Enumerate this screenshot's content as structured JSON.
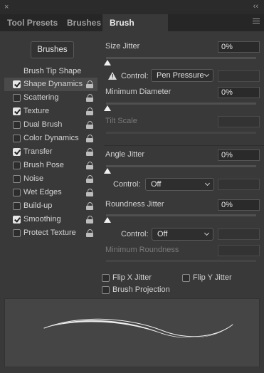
{
  "window": {
    "close_glyph": "×",
    "collapse_glyph": "‹‹"
  },
  "tabs": [
    {
      "label": "Tool Presets",
      "active": false
    },
    {
      "label": "Brushes",
      "active": false
    },
    {
      "label": "Brush Settings",
      "active": true
    }
  ],
  "left": {
    "brushes_button": "Brushes",
    "tip_shape": "Brush Tip Shape",
    "items": [
      {
        "label": "Shape Dynamics",
        "checked": true,
        "selected": true
      },
      {
        "label": "Scattering",
        "checked": false,
        "selected": false
      },
      {
        "label": "Texture",
        "checked": true,
        "selected": false
      },
      {
        "label": "Dual Brush",
        "checked": false,
        "selected": false
      },
      {
        "label": "Color Dynamics",
        "checked": false,
        "selected": false
      },
      {
        "label": "Transfer",
        "checked": true,
        "selected": false
      },
      {
        "label": "Brush Pose",
        "checked": false,
        "selected": false
      },
      {
        "label": "Noise",
        "checked": false,
        "selected": false
      },
      {
        "label": "Wet Edges",
        "checked": false,
        "selected": false
      },
      {
        "label": "Build-up",
        "checked": false,
        "selected": false
      },
      {
        "label": "Smoothing",
        "checked": true,
        "selected": false
      },
      {
        "label": "Protect Texture",
        "checked": false,
        "selected": false
      }
    ]
  },
  "settings": {
    "size_jitter": {
      "label": "Size Jitter",
      "value": "0%",
      "slider_fraction": 0
    },
    "size_control": {
      "label": "Control:",
      "selected": "Pen Pressure"
    },
    "min_diameter": {
      "label": "Minimum Diameter",
      "value": "0%",
      "slider_fraction": 0
    },
    "tilt_scale": {
      "label": "Tilt Scale"
    },
    "angle_jitter": {
      "label": "Angle Jitter",
      "value": "0%",
      "slider_fraction": 0
    },
    "angle_control": {
      "label": "Control:",
      "selected": "Off"
    },
    "roundness_jitter": {
      "label": "Roundness Jitter",
      "value": "0%",
      "slider_fraction": 0
    },
    "roundness_control": {
      "label": "Control:",
      "selected": "Off"
    },
    "min_roundness": {
      "label": "Minimum Roundness"
    },
    "flip_x": {
      "label": "Flip X Jitter",
      "checked": false
    },
    "flip_y": {
      "label": "Flip Y Jitter",
      "checked": false
    },
    "brush_projection": {
      "label": "Brush Projection",
      "checked": false
    }
  },
  "colors": {
    "panel_bg": "#393939",
    "field_bg": "#2a2a2a",
    "preview_bg": "#454545"
  }
}
